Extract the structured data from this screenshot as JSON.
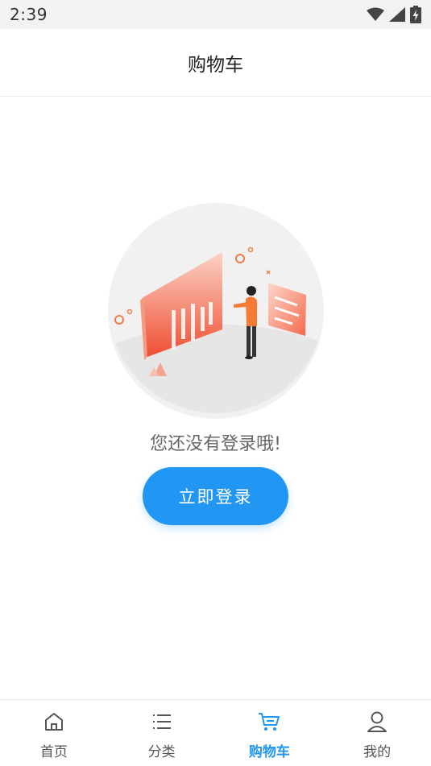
{
  "status_bar": {
    "time": "2:39"
  },
  "header": {
    "title": "购物车"
  },
  "empty_state": {
    "message": "您还没有登录哦!"
  },
  "login_button": {
    "label": "立即登录"
  },
  "tabs": [
    {
      "label": "首页",
      "icon": "home-icon",
      "active": false
    },
    {
      "label": "分类",
      "icon": "list-icon",
      "active": false
    },
    {
      "label": "购物车",
      "icon": "cart-icon",
      "active": true
    },
    {
      "label": "我的",
      "icon": "user-icon",
      "active": false
    }
  ],
  "colors": {
    "accent": "#2196f3",
    "illustration_orange": "#f05a3a",
    "status_bar_bg": "#f2f2f2"
  }
}
